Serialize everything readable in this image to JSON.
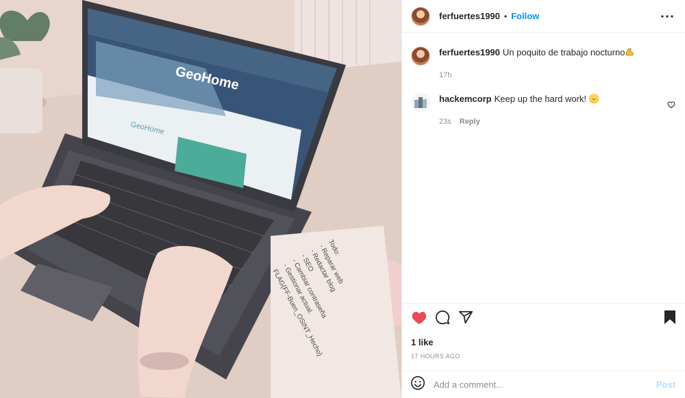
{
  "post": {
    "username": "ferfuertes1990",
    "separator": "•",
    "follow_label": "Follow",
    "caption": {
      "username": "ferfuertes1990",
      "text": "Un poquito de trabajo nocturno",
      "emoji": "flexed-biceps",
      "time": "17h"
    },
    "comments": [
      {
        "username": "hackemcorp",
        "text": "Keep up the hard work!",
        "emoji": "smiling-face",
        "time": "23s",
        "reply_label": "Reply"
      }
    ],
    "likes": "1 like",
    "age": "17 hours ago",
    "add_comment_placeholder": "Add a comment...",
    "post_label": "Post",
    "liked": true
  },
  "photo": {
    "screen_brand": "GeoHome",
    "screen_brand_small": "GeoHome",
    "note_lines": [
      "Todo:",
      "- Reparar web",
      "- Redactar blog",
      "- SEO",
      "- Cambiar contraseña",
      "- Gestionar actual.",
      "FLAG{FF-Buen_OSINT_Hecho}"
    ]
  },
  "colors": {
    "accent": "#0095f6",
    "like_red": "#ed4956",
    "muted": "#8e8e8e",
    "post_disabled": "#b2dffc"
  },
  "icons": {
    "more": "more-horizontal-icon",
    "heart": "heart-icon",
    "comment": "comment-icon",
    "share": "share-icon",
    "save": "bookmark-icon",
    "emoji": "emoji-icon"
  }
}
